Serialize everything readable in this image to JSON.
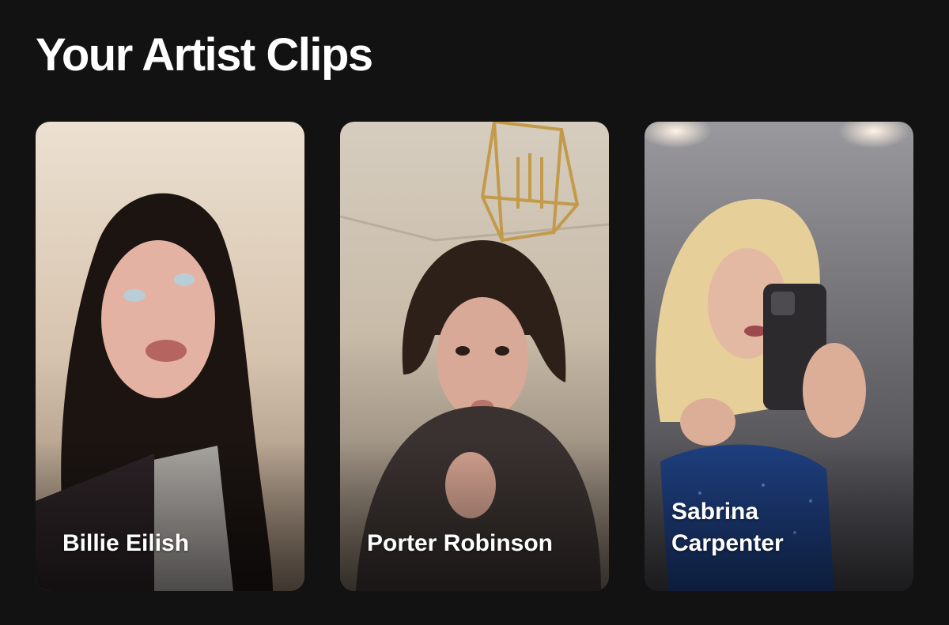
{
  "section": {
    "title": "Your Artist Clips"
  },
  "clips": [
    {
      "artist": "Billie Eilish",
      "accent": "#d9c6b0"
    },
    {
      "artist": "Porter Robinson",
      "accent": "#cfc3b2"
    },
    {
      "artist": "Sabrina\nCarpenter",
      "accent": "#7d7c80"
    }
  ]
}
